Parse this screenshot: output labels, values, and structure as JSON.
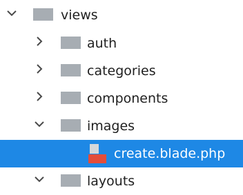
{
  "tree": {
    "root": {
      "name": "views",
      "expanded": true,
      "icon": "folder-icon"
    },
    "items": [
      {
        "name": "auth",
        "expanded": false,
        "icon": "folder-icon"
      },
      {
        "name": "categories",
        "expanded": false,
        "icon": "folder-icon"
      },
      {
        "name": "components",
        "expanded": false,
        "icon": "folder-icon"
      },
      {
        "name": "images",
        "expanded": true,
        "icon": "folder-icon"
      },
      {
        "name": "create.blade.php",
        "selected": true,
        "icon": "php-file-icon"
      },
      {
        "name": "layouts",
        "expanded": true,
        "icon": "folder-icon"
      }
    ]
  },
  "colors": {
    "selection": "#1e88e5",
    "folder": "#a7adb3",
    "chevron": "#4a4a4a",
    "php_file": "#e44d3a",
    "text": "#1f1f1f"
  }
}
